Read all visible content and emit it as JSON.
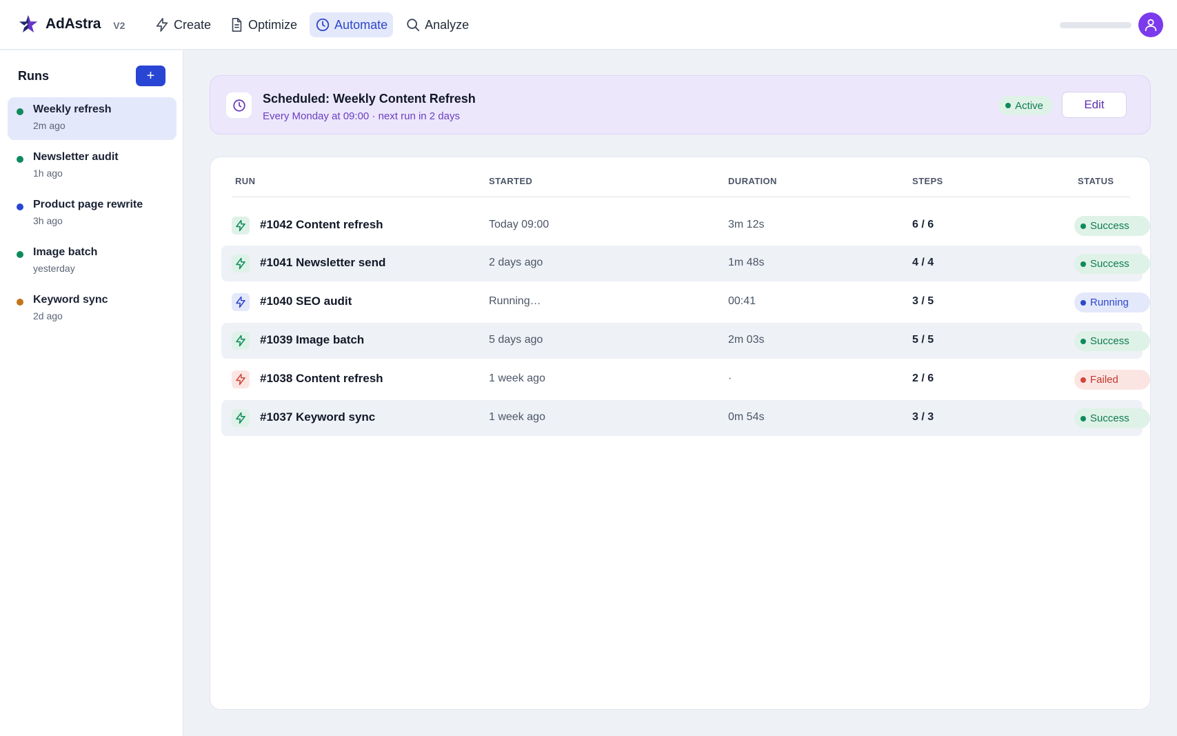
{
  "header": {
    "brand": "AdAstra",
    "version": "V2",
    "nav": [
      {
        "label": "Create",
        "icon": "bolt-icon",
        "active": false
      },
      {
        "label": "Optimize",
        "icon": "document-icon",
        "active": false
      },
      {
        "label": "Automate",
        "icon": "clock-icon",
        "active": true
      },
      {
        "label": "Analyze",
        "icon": "search-icon",
        "active": false
      }
    ],
    "avatar_icon": "user-icon"
  },
  "sidebar": {
    "title": "Runs",
    "add_label": "+",
    "items": [
      {
        "name": "Weekly refresh",
        "time": "2m ago",
        "dot_color": "#0f8a5c",
        "active": true
      },
      {
        "name": "Newsletter audit",
        "time": "1h ago",
        "dot_color": "#0f8a5c",
        "active": false
      },
      {
        "name": "Product page rewrite",
        "time": "3h ago",
        "dot_color": "#2945d3",
        "active": false
      },
      {
        "name": "Image batch",
        "time": "yesterday",
        "dot_color": "#0f8a5c",
        "active": false
      },
      {
        "name": "Keyword sync",
        "time": "2d ago",
        "dot_color": "#c2741a",
        "active": false
      }
    ]
  },
  "schedule": {
    "title": "Scheduled: Weekly Content Refresh",
    "subtitle": "Every Monday at 09:00 · next run in 2 days",
    "status": "Active",
    "edit_label": "Edit"
  },
  "table": {
    "columns": {
      "run": "RUN",
      "started": "STARTED",
      "duration": "DURATION",
      "steps": "STEPS",
      "status": "STATUS"
    },
    "rows": [
      {
        "name": "#1042 Content refresh",
        "started": "Today 09:00",
        "duration": "3m 12s",
        "steps": "6 / 6",
        "status": "Success",
        "kind": "success"
      },
      {
        "name": "#1041 Newsletter send",
        "started": "2 days ago",
        "duration": "1m 48s",
        "steps": "4 / 4",
        "status": "Success",
        "kind": "success"
      },
      {
        "name": "#1040 SEO audit",
        "started": "Running…",
        "duration": "00:41",
        "steps": "3 / 5",
        "status": "Running",
        "kind": "running"
      },
      {
        "name": "#1039 Image batch",
        "started": "5 days ago",
        "duration": "2m 03s",
        "steps": "5 / 5",
        "status": "Success",
        "kind": "success"
      },
      {
        "name": "#1038 Content refresh",
        "started": "1 week ago",
        "duration": "·",
        "steps": "2 / 6",
        "status": "Failed",
        "kind": "failed"
      },
      {
        "name": "#1037 Keyword sync",
        "started": "1 week ago",
        "duration": "0m 54s",
        "steps": "3 / 3",
        "status": "Success",
        "kind": "success"
      }
    ]
  },
  "colors": {
    "accent": "#2945d3",
    "success": "#0f8a5c",
    "running": "#2f47c9",
    "failed": "#d2453a",
    "schedule_bg": "#ece7fb"
  }
}
